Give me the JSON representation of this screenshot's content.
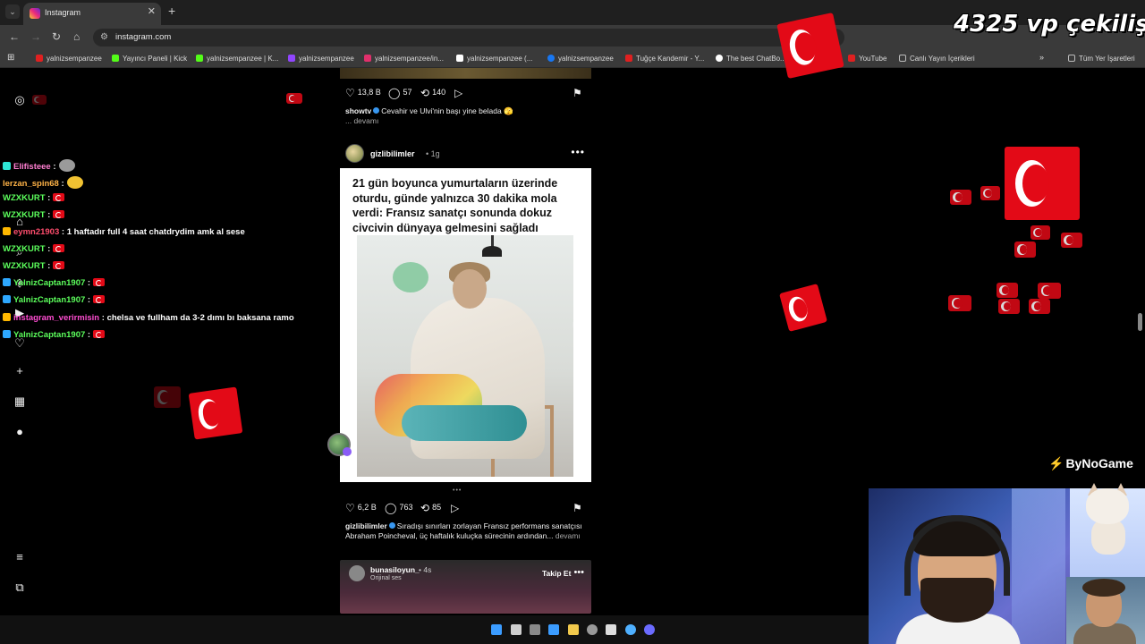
{
  "browser": {
    "tab_title": "Instagram",
    "tab_close": "✕",
    "new_tab": "+",
    "tab_menu": "⌄",
    "url": "instagram.com",
    "bookmarks": [
      {
        "label": "yalnizsempanzee",
        "color": "#e02020"
      },
      {
        "label": "Yayıncı Paneli | Kick",
        "color": "#53fc18"
      },
      {
        "label": "yalnizsempanzee | K...",
        "color": "#53fc18"
      },
      {
        "label": "yalnizsempanzee",
        "color": "#9146ff"
      },
      {
        "label": "yalnizsempanzee/in...",
        "color": "#e1306c"
      },
      {
        "label": "yalnizsempanzee (...",
        "color": "#ffffff"
      },
      {
        "label": "yalnizsempanzee",
        "color": "#1877f2"
      },
      {
        "label": "Tuğçe Kandemir - Y...",
        "color": "#e02020"
      },
      {
        "label": "The best ChatBo...",
        "color": "#ffffff"
      },
      {
        "label": "YouTube",
        "color": "#e02020"
      },
      {
        "label": "Canlı Yayın İçerikleri",
        "color": "#bbbbbb"
      },
      {
        "label": "Tüm Yer İşaretleri",
        "color": "#bbbbbb"
      }
    ]
  },
  "overlay": {
    "title": "4325 vp çekiliş",
    "brand": "ByNoGame"
  },
  "chat": [
    {
      "user": "Elifisteee",
      "msg": "",
      "user_color": "#ff7fd1",
      "badge": "#2ee6d6",
      "extra": "emote"
    },
    {
      "user": "lerzan_spin68",
      "msg": "",
      "user_color": "#ffb347",
      "badge": "",
      "extra": "emote2"
    },
    {
      "user": "WZXKURT",
      "msg": "",
      "user_color": "#5cff5c",
      "badge": "",
      "extra": "flag"
    },
    {
      "user": "WZXKURT",
      "msg": "",
      "user_color": "#5cff5c",
      "badge": "",
      "extra": "flag"
    },
    {
      "user": "eymn21903",
      "msg": "1 haftadır full 4 saat chatdrydim amk al sese",
      "user_color": "#ff4d6d",
      "badge": "#ffb800",
      "extra": ""
    },
    {
      "user": "WZXKURT",
      "msg": "",
      "user_color": "#5cff5c",
      "badge": "",
      "extra": "flag"
    },
    {
      "user": "WZXKURT",
      "msg": "",
      "user_color": "#5cff5c",
      "badge": "",
      "extra": "flag"
    },
    {
      "user": "YalnizCaptan1907",
      "msg": "",
      "user_color": "#5cff5c",
      "badge": "#2ea8ff",
      "extra": "flag"
    },
    {
      "user": "YalnizCaptan1907",
      "msg": "",
      "user_color": "#5cff5c",
      "badge": "#2ea8ff",
      "extra": "flag"
    },
    {
      "user": "instagram_verirmisin",
      "msg": "chelsa ve fullham da 3-2 dımı bı baksana ramo",
      "user_color": "#ff4dd2",
      "badge": "#ffb800",
      "extra": ""
    },
    {
      "user": "YalnizCaptan1907",
      "msg": "",
      "user_color": "#5cff5c",
      "badge": "#2ea8ff",
      "extra": "flag"
    }
  ],
  "chat_sep": ":",
  "feed": {
    "post1": {
      "likes": "13,8 B",
      "comments": "57",
      "reposts": "140",
      "author": "showtv",
      "caption": "Cevahir ve Ulvi'nin başı yine belada 🫣",
      "more": "... devamı"
    },
    "post2": {
      "author": "gizlibilimler",
      "time": "• 1g",
      "more_icon": "•••",
      "media_caption": "21 gün boyunca yumurtaların üzerinde oturdu, günde yalnızca 30 dakika mola verdi: Fransız sanatçı sonunda dokuz civcivin dünyaya gelmesini sağladı",
      "likes": "6,2 B",
      "comments": "763",
      "reposts": "85",
      "caption": "Sıradışı sınırları zorlayan Fransız performans sanatçısı Abraham Poincheval, üç haftalık kuluçka sürecinin ardından...",
      "more": "devamı",
      "carousel_dots": "•••"
    },
    "post3": {
      "author": "bunasiloyun_",
      "time": "• 4s",
      "sub": "Orijinal ses",
      "follow": "Takip Et",
      "more_icon": "•••"
    }
  },
  "icons": {
    "heart": "♡",
    "comment": "◯",
    "repost": "⟲",
    "share": "▷",
    "bookmark": "⚑"
  },
  "colors": {
    "flag_red": "#e30a17",
    "page_bg": "#000000",
    "chrome_bg": "#3a3a3a"
  }
}
